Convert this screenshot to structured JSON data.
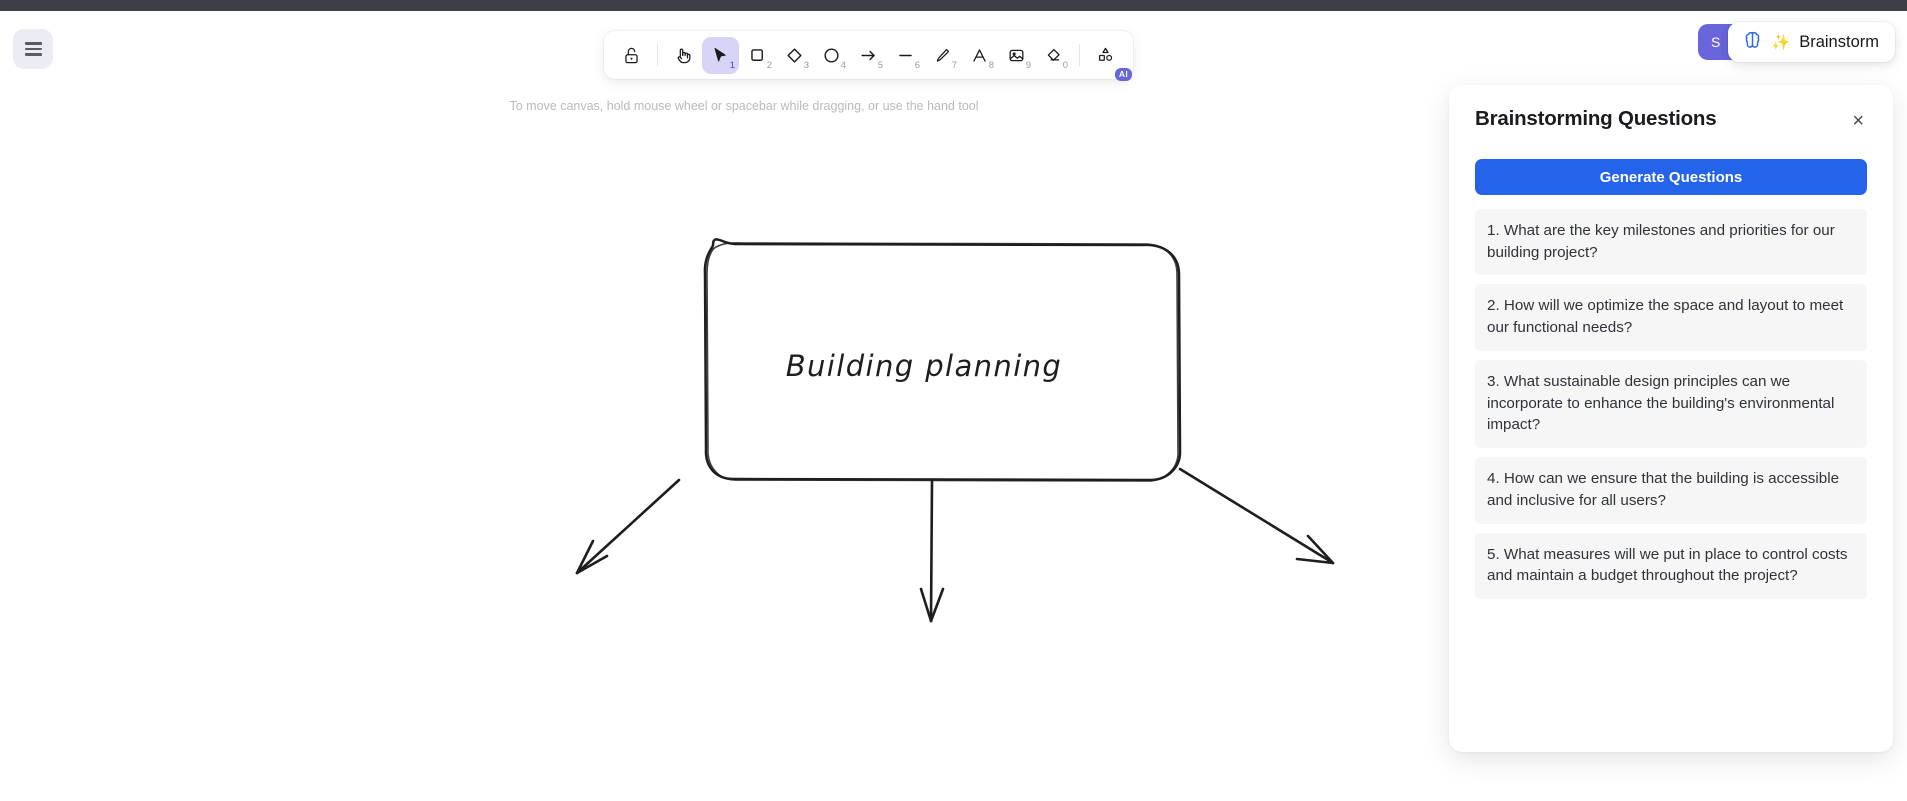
{
  "menu": {
    "icon": "hamburger-menu-icon"
  },
  "toolbar": {
    "hint": "To move canvas, hold mouse wheel or spacebar while dragging, or use the hand tool",
    "tools": [
      {
        "name": "lock-icon",
        "label": "Keep selected tool active after drawing",
        "key": "",
        "active": false
      },
      {
        "name": "hand-icon",
        "label": "Hand (panning tool)",
        "key": "",
        "active": false
      },
      {
        "name": "selection-icon",
        "label": "Selection",
        "key": "1",
        "active": true
      },
      {
        "name": "rectangle-icon",
        "label": "Rectangle",
        "key": "2",
        "active": false
      },
      {
        "name": "diamond-icon",
        "label": "Diamond",
        "key": "3",
        "active": false
      },
      {
        "name": "ellipse-icon",
        "label": "Ellipse",
        "key": "4",
        "active": false
      },
      {
        "name": "arrow-icon",
        "label": "Arrow",
        "key": "5",
        "active": false
      },
      {
        "name": "line-icon",
        "label": "Line",
        "key": "6",
        "active": false
      },
      {
        "name": "draw-icon",
        "label": "Draw",
        "key": "7",
        "active": false
      },
      {
        "name": "text-icon",
        "label": "Text",
        "key": "8",
        "active": false
      },
      {
        "name": "image-icon",
        "label": "Insert image",
        "key": "9",
        "active": false
      },
      {
        "name": "eraser-icon",
        "label": "Eraser",
        "key": "0",
        "active": false
      },
      {
        "name": "ai-shapes-icon",
        "label": "Wireframe to code",
        "key": "",
        "active": false,
        "badge": "AI"
      }
    ]
  },
  "header": {
    "share_label": "S",
    "brainstorm_label": "Brainstorm",
    "brainstorm_sparkle": "✨",
    "brain_icon": "brain-icon"
  },
  "canvas": {
    "shape_label": "Building planning",
    "stroke_color": "#1e1e1e",
    "arrows": [
      "arrow-bottom-left",
      "arrow-bottom-center",
      "arrow-bottom-right"
    ]
  },
  "panel": {
    "title": "Brainstorming Questions",
    "close_label": "×",
    "generate_label": "Generate Questions",
    "accent_color": "#2563eb",
    "questions": [
      "1. What are the key milestones and priorities for our building project?",
      "2. How will we optimize the space and layout to meet our functional needs?",
      "3. What sustainable design principles can we incorporate to enhance the building's environmental impact?",
      "4. How can we ensure that the building is accessible and inclusive for all users?",
      "5. What measures will we put in place to control costs and maintain a budget throughout the project?"
    ]
  }
}
